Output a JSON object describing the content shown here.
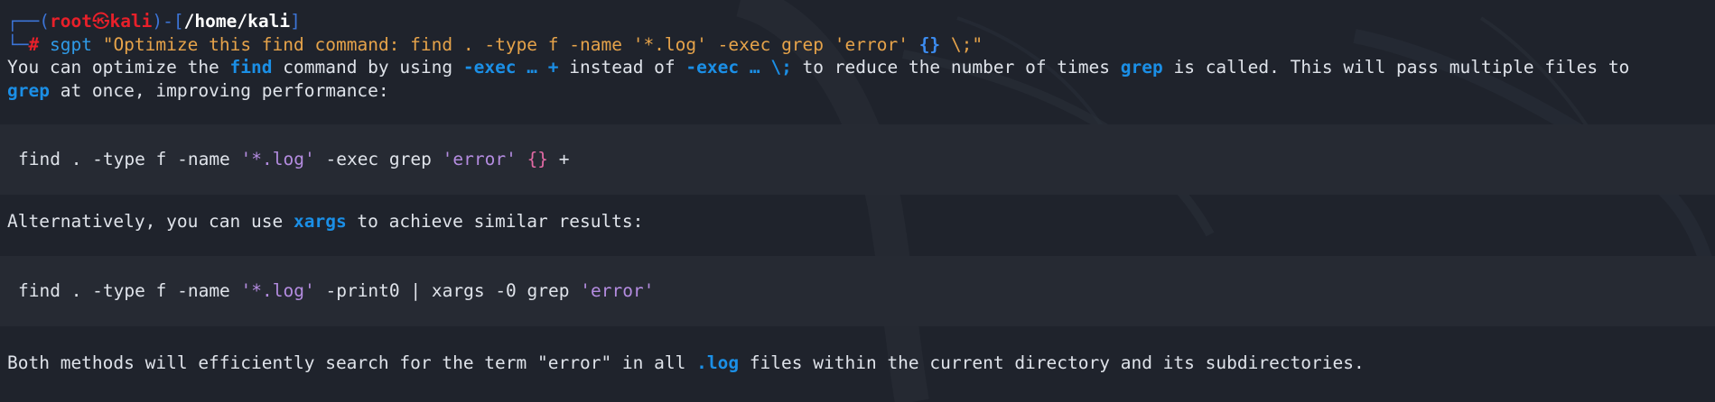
{
  "prompt": {
    "frame_top_left": "┌──(",
    "user": "root",
    "at_symbol": "㉿",
    "host": "kali",
    "frame_mid": ")-[",
    "path": "/home/kali",
    "frame_end": "]",
    "frame_bottom": "└─",
    "hash": "#"
  },
  "command": {
    "program": "sgpt",
    "arg_part1": "\"Optimize this find command: find . -type f -name '*.log' -exec grep 'error' ",
    "arg_braces": "{}",
    "arg_part2": " \\;\""
  },
  "response": {
    "p1_a": "You can optimize the ",
    "p1_find": "find",
    "p1_b": " command by using ",
    "p1_exec_plus": "-exec … +",
    "p1_c": " instead of ",
    "p1_exec_semi": "-exec … \\;",
    "p1_d": " to reduce the number of times ",
    "p1_grep": "grep",
    "p1_e": " is called. This will pass multiple files to",
    "p1_grep2": "grep",
    "p1_f": " at once, improving performance:",
    "code1_a": "find . -type f -name ",
    "code1_str1": "'*.log'",
    "code1_b": " -exec grep ",
    "code1_str2": "'error'",
    "code1_c": " ",
    "code1_braces": "{}",
    "code1_d": " +",
    "p2_a": "Alternatively, you can use ",
    "p2_xargs": "xargs",
    "p2_b": " to achieve similar results:",
    "code2_a": "find . -type f -name ",
    "code2_str1": "'*.log'",
    "code2_b": " -print0 | xargs -0 grep ",
    "code2_str2": "'error'",
    "p3_a": "Both methods will efficiently search for the term \"error\" in all ",
    "p3_log": ".log",
    "p3_b": " files within the current directory and its subdirectories."
  },
  "colors": {
    "background": "#1f232c",
    "codeblock_bg": "#262a33",
    "highlight_blue": "#1b8fe6",
    "prompt_red": "#e8202a",
    "prompt_frame_blue": "#3c74d6",
    "command_orange": "#e6a34a",
    "string_purple": "#b48ce0"
  }
}
